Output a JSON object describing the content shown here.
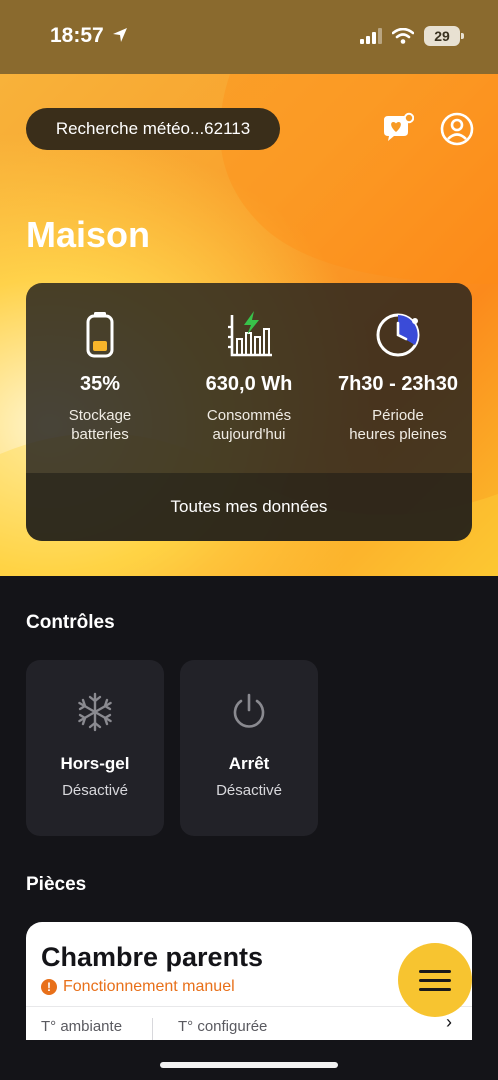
{
  "status_bar": {
    "time": "18:57",
    "battery": "29",
    "icons": [
      "location-arrow-icon",
      "signal-icon",
      "wifi-icon",
      "battery-icon"
    ]
  },
  "header": {
    "search_label": "Recherche météo...62113",
    "icons": [
      "heart-chat-icon",
      "profile-icon"
    ]
  },
  "home": {
    "title": "Maison"
  },
  "stats": {
    "items": [
      {
        "icon": "battery-level-icon",
        "value": "35%",
        "label_line1": "Stockage",
        "label_line2": "batteries"
      },
      {
        "icon": "energy-bars-icon",
        "value": "630,0 Wh",
        "label_line1": "Consommés",
        "label_line2": "aujourd'hui"
      },
      {
        "icon": "clock-period-icon",
        "value": "7h30 - 23h30",
        "label_line1": "Période",
        "label_line2": "heures pleines"
      }
    ],
    "footer_label": "Toutes mes données"
  },
  "controls": {
    "title": "Contrôles",
    "items": [
      {
        "icon": "snowflake-icon",
        "name": "Hors-gel",
        "state": "Désactivé"
      },
      {
        "icon": "power-icon",
        "name": "Arrêt",
        "state": "Désactivé"
      }
    ]
  },
  "rooms": {
    "title": "Pièces",
    "items": [
      {
        "name": "Chambre parents",
        "status": "Fonctionnement manuel",
        "status_icon": "!",
        "col1_label": "T° ambiante",
        "col2_label": "T° configurée",
        "chevron": "›"
      }
    ]
  },
  "fab": {
    "icon": "menu-icon"
  },
  "colors": {
    "accent_yellow": "#f7c430",
    "accent_orange": "#fb8a1c",
    "warning": "#e8701a",
    "background": "#141418",
    "card": "#222228"
  }
}
